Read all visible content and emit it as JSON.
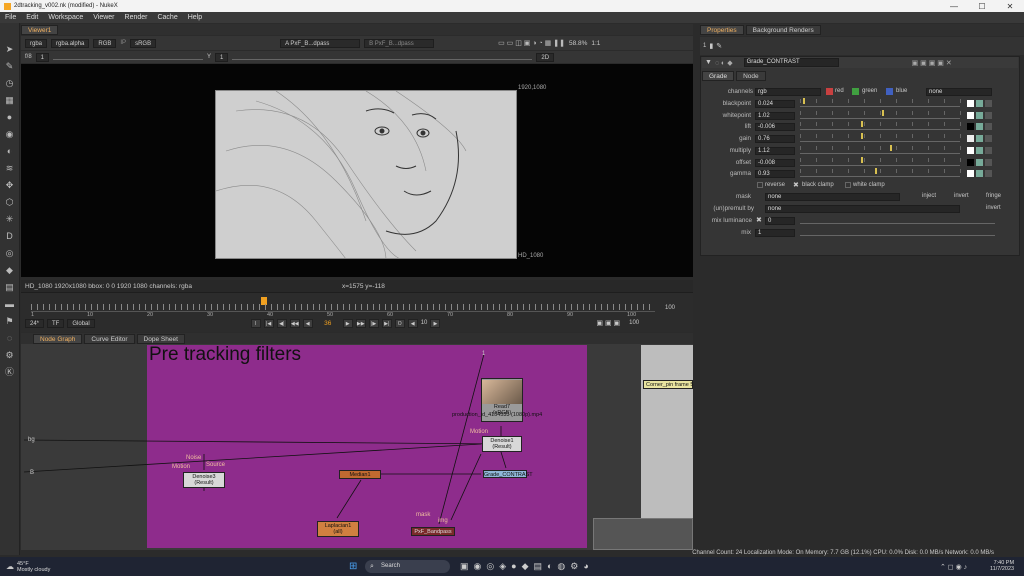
{
  "window": {
    "title": "2dtracking_v002.nk (modified) - NukeX"
  },
  "menu": [
    "File",
    "Edit",
    "Workspace",
    "Viewer",
    "Render",
    "Cache",
    "Help"
  ],
  "viewer": {
    "tab": "Viewer1",
    "channels": "rgba",
    "alpha": "rgba.alpha",
    "display": "RGB",
    "ip": "IP",
    "colorspace": "sRGB",
    "inputA": "A  PxF_B...dpass",
    "inputB": "B  PxF_B...dpass",
    "zoom": "58.8%",
    "ratio": "1:1",
    "mode": "2D",
    "fstop": "f/8",
    "frame": "1",
    "y_label": "Y",
    "y_value": "1",
    "format_top": "1920,1080",
    "format_bottom": "HD_1080",
    "info": "HD_1080 1920x1080  bbox: 0 0 1920 1080 channels: rgba",
    "coords": "x=1575 y=-118"
  },
  "timeline": {
    "ticks": [
      "1",
      "10",
      "20",
      "30",
      "40",
      "50",
      "60",
      "70",
      "80",
      "90",
      "100"
    ],
    "end": "100",
    "fps": "24*",
    "tf": "TF",
    "range": "Global",
    "current_frame": "36",
    "step": "10",
    "out": "100",
    "marker": "36"
  },
  "nodegraph": {
    "tabs": [
      "Node Graph",
      "Curve Editor",
      "Dope Sheet"
    ],
    "backdrop_title": "Pre tracking filters",
    "nodes": {
      "read": {
        "name": "Read7",
        "file": "production_id_4154533 (1080p).mp4",
        "cs": "(sRGB)"
      },
      "denoise1": {
        "name": "Denoise1",
        "sub": "(Result)"
      },
      "denoise3": {
        "name": "Denoise3",
        "sub": "(Result)"
      },
      "median": {
        "name": "Median1"
      },
      "grade": {
        "name": "Grade_CONTRAST"
      },
      "laplacian": {
        "name": "Laplacian1",
        "sub": "(all)"
      },
      "bandpass": {
        "name": "PxF_Bandpass"
      },
      "corner": {
        "name": "Corner_pin frame 5"
      }
    },
    "labels": {
      "noise": "Noise",
      "motion": "Motion",
      "source": "Source",
      "motion2": "Motion",
      "mask": "mask",
      "img": "img",
      "bg": "bg",
      "b": "B",
      "one": "1"
    }
  },
  "properties": {
    "tabs": [
      "Properties",
      "Background Renders"
    ],
    "count": "1",
    "node_name": "Grade_CONTRAST",
    "subtabs": [
      "Grade",
      "Node"
    ],
    "channels_label": "channels",
    "channels": "rgb",
    "red": "red",
    "green": "green",
    "blue": "blue",
    "none": "none",
    "knobs": [
      {
        "label": "blackpoint",
        "value": "0.024",
        "pos": 0.02
      },
      {
        "label": "whitepoint",
        "value": "1.02",
        "pos": 0.51
      },
      {
        "label": "lift",
        "value": "-0.006",
        "pos": 0.38
      },
      {
        "label": "gain",
        "value": "0.76",
        "pos": 0.38
      },
      {
        "label": "multiply",
        "value": "1.12",
        "pos": 0.56
      },
      {
        "label": "offset",
        "value": "-0.008",
        "pos": 0.38
      },
      {
        "label": "gamma",
        "value": "0.93",
        "pos": 0.47
      }
    ],
    "reverse": "reverse",
    "black_clamp": "black clamp",
    "white_clamp": "white clamp",
    "mask_label": "mask",
    "mask": "none",
    "inject": "inject",
    "invert": "invert",
    "fringe": "fringe",
    "unpremult_label": "(un)premult by",
    "unpremult": "none",
    "invert2": "invert",
    "mix_lum_label": "mix luminance",
    "mix_lum": "0",
    "mix_label": "mix",
    "mix": "1"
  },
  "status": {
    "text": "Channel Count: 24  Localization Mode: On  Memory: 7.7 GB (12.1%)  CPU: 0.0%  Disk: 0.0 MB/s  Network: 0.0 MB/s"
  },
  "taskbar": {
    "weather_temp": "45°F",
    "weather_desc": "Mostly cloudy",
    "search": "Search",
    "time": "7:40 PM",
    "date": "11/7/2023"
  }
}
